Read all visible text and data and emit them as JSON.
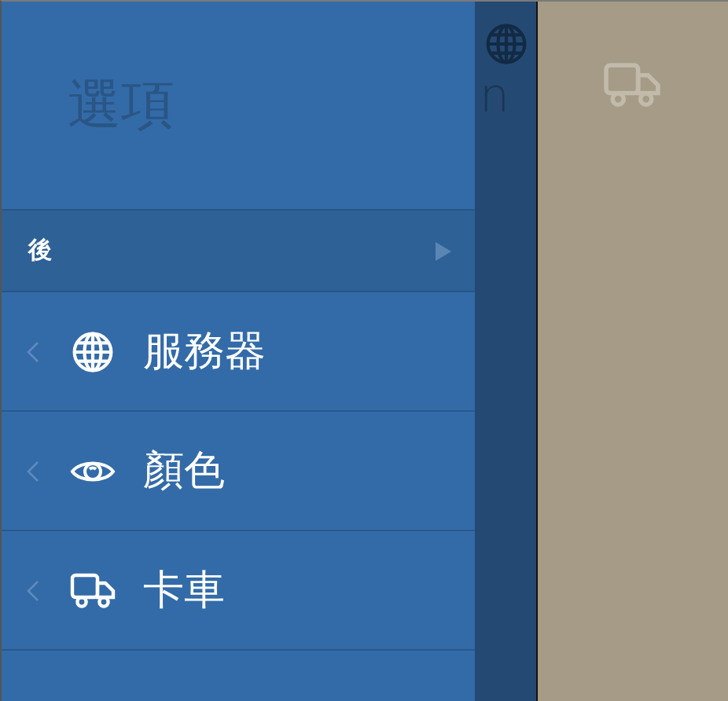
{
  "menu": {
    "title": "選項",
    "back": {
      "label": "後"
    },
    "items": [
      {
        "label": "服務器",
        "kind": "globe"
      },
      {
        "label": "顏色",
        "kind": "eye"
      },
      {
        "label": "卡車",
        "kind": "truck"
      }
    ]
  },
  "background": {
    "title_fragment": "n"
  }
}
